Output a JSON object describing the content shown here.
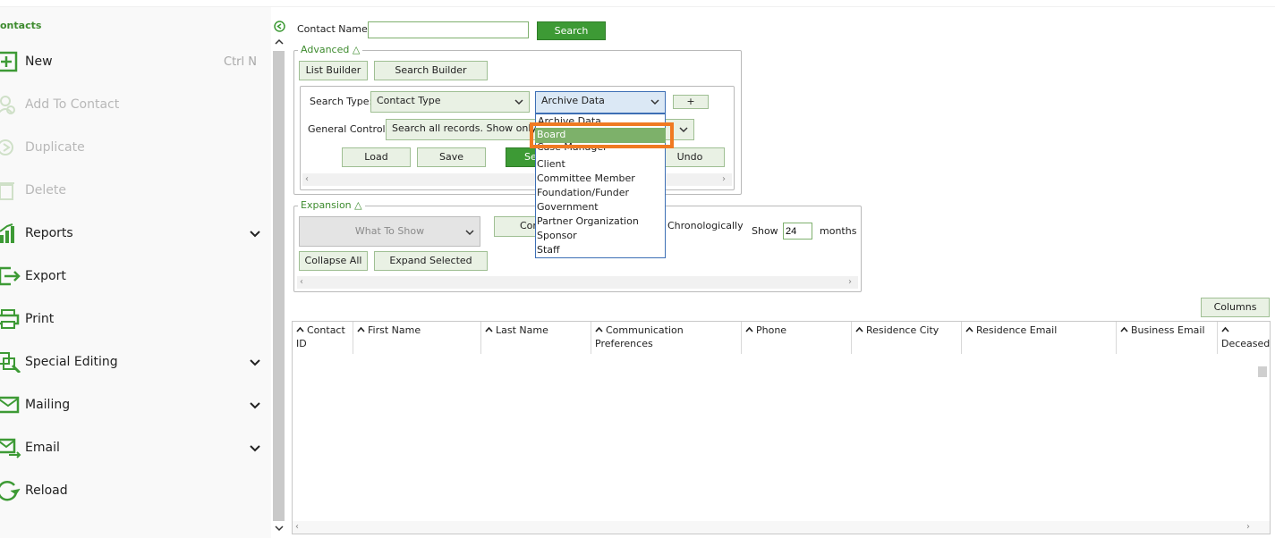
{
  "sidebar": {
    "title": "ontacts",
    "items": [
      {
        "label": "New",
        "shortcut": "Ctrl N"
      },
      {
        "label": "Add To Contact"
      },
      {
        "label": "Duplicate"
      },
      {
        "label": "Delete"
      },
      {
        "label": "Reports"
      },
      {
        "label": "Export"
      },
      {
        "label": "Print"
      },
      {
        "label": "Special Editing"
      },
      {
        "label": "Mailing"
      },
      {
        "label": "Email"
      },
      {
        "label": "Reload"
      }
    ]
  },
  "search": {
    "contact_name_label": "Contact Name",
    "contact_name_value": "",
    "search_button": "Search"
  },
  "advanced": {
    "legend": "Advanced △",
    "list_builder": "List Builder",
    "search_builder": "Search Builder",
    "search_type_label": "Search Type:",
    "search_type_value": "Contact Type",
    "archive_value": "Archive Data",
    "plus_button": "+",
    "general_control_label": "General Control:",
    "general_control_value": "Search all records. Show only m",
    "load": "Load",
    "save": "Save",
    "search_partial": "Se",
    "undo": "Undo"
  },
  "dropdown": {
    "items": [
      "Archive Data",
      "Board",
      "Case Manager",
      "Client",
      "Committee Member",
      "Foundation/Funder",
      "Government",
      "Partner Organization",
      "Sponsor",
      "Staff"
    ],
    "highlighted": "Board"
  },
  "expansion": {
    "legend": "Expansion △",
    "what_to_show": "What To Show",
    "con_partial": "Con",
    "chronologically": "Chronologically",
    "show_label": "Show",
    "months_value": "24",
    "months_label": "months",
    "collapse_all": "Collapse All",
    "expand_selected": "Expand Selected"
  },
  "grid": {
    "columns_button": "Columns",
    "headers": [
      "Contact ID",
      "First Name",
      "Last Name",
      "Communication Preferences",
      "Phone",
      "Residence City",
      "Residence Email",
      "Business Email",
      "Deceased"
    ]
  },
  "colors": {
    "accent": "#3d9a35",
    "highlight_box": "#f07a22",
    "selected_item": "#7db16a"
  }
}
